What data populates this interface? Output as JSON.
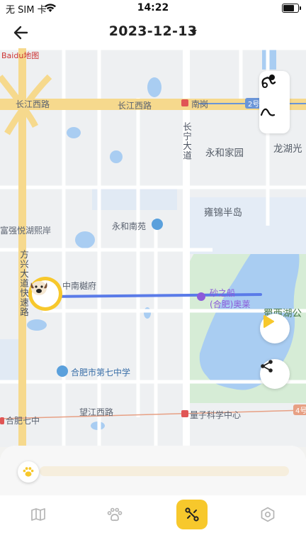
{
  "status_bar": {
    "carrier": "无 SIM 卡",
    "time": "14:22"
  },
  "header": {
    "date": "2023-12-13"
  },
  "map": {
    "provider_logo": "Baidu地图",
    "labels": {
      "road_changjiang_west_1": "长江西路",
      "road_changjiang_west_2": "长江西路",
      "poi_nangang": "南岗",
      "line_badge": "2号",
      "road_changning": "长宁大道",
      "poi_yonghe_home": "永和家园",
      "poi_longhu": "龙湖光",
      "poi_yongjin": "雍锦半岛",
      "poi_fuqiang": "富强悦湖熙岸",
      "poi_yonghe_garden": "永和南苑",
      "road_fangxing": "方兴大道快速路",
      "poi_zhongnan": "中南樾府",
      "poi_outlets": "砂之船",
      "poi_outlets_2": "(合肥)奥莱",
      "poi_shuxi_lake": "蜀西湖公",
      "poi_school": "合肥市第七中学",
      "road_wangjiang_west": "望江西路",
      "poi_hefei_seven": "合肥七中",
      "poi_quantum": "量子科学中心",
      "line_badge_4": "4号"
    },
    "icons": {
      "tool_1": "pet-route-icon",
      "tool_2": "curve-icon",
      "play": "play-icon",
      "share": "share-icon",
      "avatar": "dog-face-icon"
    }
  },
  "timeline": {
    "progress": 0.0
  },
  "tabbar": {
    "tabs": [
      {
        "name": "map",
        "icon": "map-icon",
        "active": false
      },
      {
        "name": "pet",
        "icon": "paw-icon",
        "active": false
      },
      {
        "name": "track",
        "icon": "route-icon",
        "active": true
      },
      {
        "name": "settings",
        "icon": "hexagon-settings-icon",
        "active": false
      }
    ]
  },
  "colors": {
    "accent": "#f7c82c",
    "route": "#5a7be8",
    "water": "#a9cdf2",
    "park": "#d6ecd6"
  }
}
